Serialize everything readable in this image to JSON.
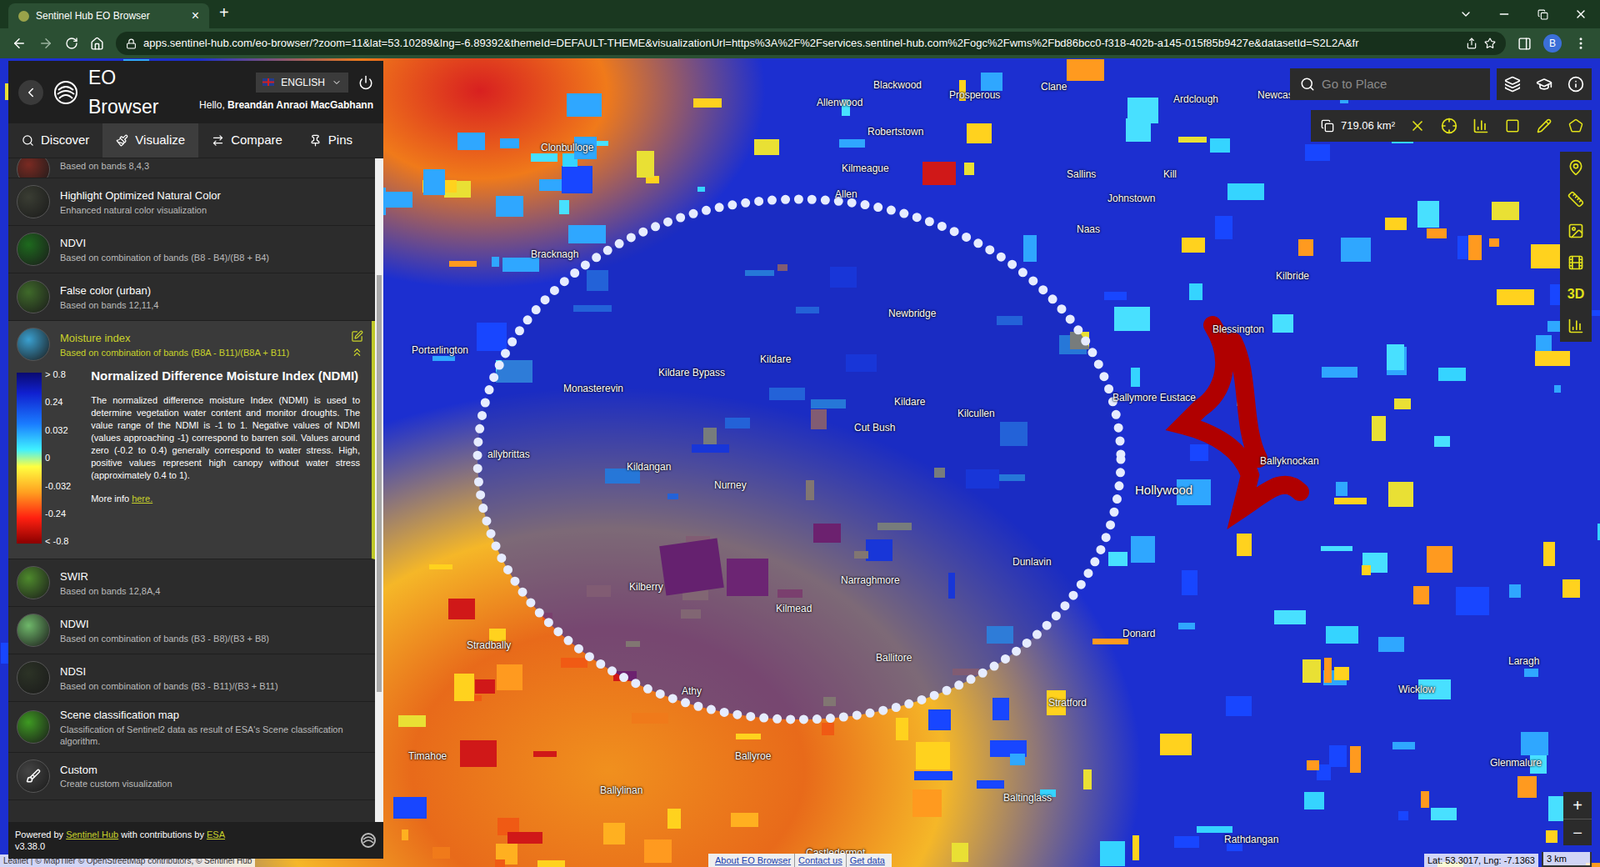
{
  "browser": {
    "tab_title": "Sentinel Hub EO Browser",
    "tab_close": "×",
    "new_tab": "+",
    "url": "apps.sentinel-hub.com/eo-browser/?zoom=11&lat=53.10289&lng=-6.89392&themeId=DEFAULT-THEME&visualizationUrl=https%3A%2F%2Fservices.sentinel-hub.com%2Fogc%2Fwms%2Fbd86bcc0-f318-402b-a145-015f85b9427e&datasetId=S2L2A&fr",
    "profile_initial": "B"
  },
  "panel": {
    "app_name": "EO Browser",
    "language": "ENGLISH",
    "greeting": "Hello,",
    "user": "Breandán Anraoi MacGabhann",
    "tabs": [
      {
        "label": "Discover",
        "selected": false
      },
      {
        "label": "Visualize",
        "selected": true
      },
      {
        "label": "Compare",
        "selected": false
      },
      {
        "label": "Pins",
        "selected": false
      }
    ],
    "layers": [
      {
        "kind": "partial",
        "title": "",
        "subtitle": "Based on bands 8,4,3",
        "color": "#7a2a22",
        "selected": false,
        "expanded": false
      },
      {
        "kind": "layer",
        "title": "Highlight Optimized Natural Color",
        "subtitle": "Enhanced natural color visualization",
        "color": "#3a3d33",
        "selected": false,
        "expanded": false
      },
      {
        "kind": "layer",
        "title": "NDVI",
        "subtitle": "Based on combination of bands (B8 - B4)/(B8 + B4)",
        "color": "#1e6a1e",
        "selected": false,
        "expanded": false
      },
      {
        "kind": "layer",
        "title": "False color (urban)",
        "subtitle": "Based on bands 12,11,4",
        "color": "#3f6a2a",
        "selected": false,
        "expanded": false
      },
      {
        "kind": "layer",
        "title": "Moisture index",
        "subtitle": "Based on combination of bands (B8A - B11)/(B8A + B11)",
        "color": "#3aa0d0",
        "selected": true,
        "expanded": true
      },
      {
        "kind": "layer",
        "title": "SWIR",
        "subtitle": "Based on bands 12,8A,4",
        "color": "#4e8a2c",
        "selected": false,
        "expanded": false
      },
      {
        "kind": "layer",
        "title": "NDWI",
        "subtitle": "Based on combination of bands (B3 - B8)/(B3 + B8)",
        "color": "#6fb86a",
        "selected": false,
        "expanded": false
      },
      {
        "kind": "layer",
        "title": "NDSI",
        "subtitle": "Based on combination of bands (B3 - B11)/(B3 + B11)",
        "color": "#2c3326",
        "selected": false,
        "expanded": false
      },
      {
        "kind": "layer",
        "title": "Scene classification map",
        "subtitle": "Classification of Sentinel2 data as result of ESA's Scene classification algorithm.",
        "color": "#3e9a22",
        "selected": false,
        "expanded": false
      },
      {
        "kind": "custom",
        "title": "Custom",
        "subtitle": "Create custom visualization",
        "color": "#444444",
        "selected": false,
        "expanded": false
      }
    ],
    "legend": {
      "title": "Normalized Difference Moisture Index (NDMI)",
      "ticks": [
        "> 0.8",
        "0.24",
        "0.032",
        "0",
        "-0.032",
        "-0.24",
        "< -0.8"
      ],
      "description": "The normalized difference moisture Index (NDMI) is used to determine vegetation water content and monitor droughts. The value range of the NDMI is -1 to 1. Negative values of NDMI (values approaching -1) correspond to barren soil. Values around zero (-0.2 to 0.4) generally correspond to water stress. High, positive values represent high canopy without water stress (approximately 0.4 to 1).",
      "more_info": "More info",
      "link": "here."
    },
    "footer": {
      "powered": "Powered by",
      "sentinel": "Sentinel Hub",
      "contrib": "with contributions by",
      "esa": "ESA",
      "version": "v3.38.0"
    }
  },
  "map": {
    "search_placeholder": "Go to Place",
    "area": "719.06 km²",
    "mode_3d": "3D",
    "zoom_in": "+",
    "zoom_out": "−",
    "coords": "Lat: 53.3017, Lng: -7.1363",
    "scale": "3 km",
    "links": [
      "About EO Browser",
      "Contact us",
      "Get data"
    ],
    "attribution": "Leaflet | © MapTiler © OpenStreetMap contributors, © Sentinel Hub",
    "labels": [
      "Blackwood",
      "Prosperous",
      "Clane",
      "Ardclough",
      "Newcastle",
      "Allenwood",
      "Robertstown",
      "Clonbulloge",
      "Kilmeague",
      "Sallins",
      "Kill",
      "Johnstown",
      "Allen",
      "Naas",
      "Bracknagh",
      "Kilbride",
      "Newbridge",
      "Blessington",
      "Portarlington",
      "Kildare",
      "Kildare Bypass",
      "Monasterevin",
      "Kildare",
      "Ballymore Eustace",
      "Kilcullen",
      "Cut Bush",
      "allybrittas",
      "Kildangan",
      "Ballyknockan",
      "Hollywood",
      "Nurney",
      "Dunlavin",
      "Kilberry",
      "Narraghmore",
      "Kilmead",
      "Donard",
      "Stradbally",
      "Ballitore",
      "Laragh",
      "Athy",
      "Wicklow",
      "Stratford",
      "Ballyroe",
      "Timahoe",
      "Glenmalure",
      "Ballylinan",
      "Baltinglass",
      "Rathdangan",
      "Castledermot"
    ]
  }
}
